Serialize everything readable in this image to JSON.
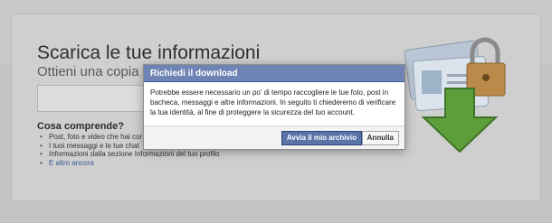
{
  "background": {
    "title": "Scarica le tue informazioni",
    "subtitle": "Ottieni una copia de",
    "section_title": "Cosa comprende?",
    "items": [
      "Post, foto e video che hai cor",
      "I tuoi messaggi e le tue chat",
      "Informazioni dalla sezione Informazioni del tuo profilo",
      "E altro ancora"
    ],
    "art_icons": [
      "id-card-icon",
      "padlock-icon",
      "download-arrow-icon"
    ]
  },
  "dialog": {
    "title": "Richiedi il download",
    "message": "Potrebbe essere necessario un po' di tempo raccogliere le tue foto, post in bacheca, messaggi e altre informazioni. In seguito ti chiederemo di verificare la tua identità, al fine di proteggere la sicurezza del tuo account.",
    "primary_button": "Avvia il mio archivio",
    "secondary_button": "Annulla"
  },
  "colors": {
    "header_blue": "#6d84b4",
    "primary_button": "#5b74a8",
    "link": "#3b5998",
    "arrow_green": "#5e9e3a"
  }
}
